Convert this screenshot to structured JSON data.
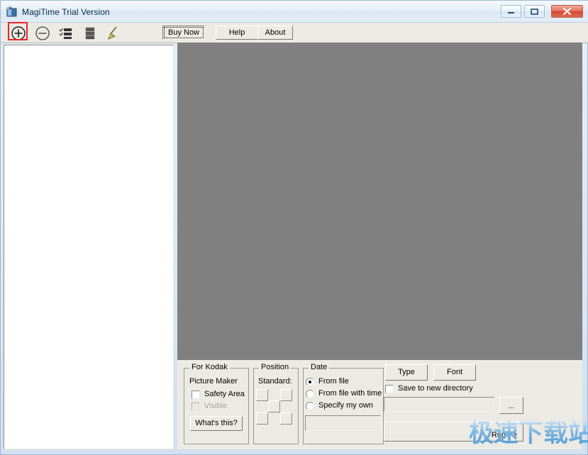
{
  "window": {
    "title": "MagiTime Trial Version",
    "icon": "photo-app-icon",
    "controls": {
      "minimize": "minimize-icon",
      "maximize": "maximize-icon",
      "close": "close-icon"
    }
  },
  "toolbar": {
    "icons": [
      {
        "name": "add-icon",
        "tooltip": "Add"
      },
      {
        "name": "remove-icon",
        "tooltip": "Remove"
      },
      {
        "name": "select-list-icon",
        "tooltip": "Select All"
      },
      {
        "name": "list-icon",
        "tooltip": "List"
      },
      {
        "name": "broom-icon",
        "tooltip": "Clear"
      }
    ],
    "selected_icon_index": 0,
    "buttons": {
      "buy_now": "Buy Now",
      "help": "Help",
      "about": "About"
    }
  },
  "left_panel": {
    "name": "file-list",
    "items": []
  },
  "preview": {
    "name": "image-preview-area",
    "background_color": "#808080"
  },
  "bottom": {
    "kodak_group": {
      "legend": "For Kodak",
      "subtitle": "Picture Maker",
      "checkboxes": [
        {
          "label": "Safety Area",
          "checked": false,
          "enabled": true
        },
        {
          "label": "Visible",
          "checked": false,
          "enabled": false
        }
      ],
      "button": "What's this?"
    },
    "position_group": {
      "legend": "Position",
      "subtitle": "Standard:",
      "cells": 9
    },
    "date_group": {
      "legend": "Date",
      "radios": [
        {
          "label": "From file",
          "selected": true
        },
        {
          "label": "From file with time",
          "selected": false
        },
        {
          "label": "Specify my own",
          "selected": false
        }
      ],
      "custom_date_value": "",
      "custom_date_placeholder": ""
    },
    "actions": {
      "type_button": "Type",
      "font_button": "Font",
      "save_checkbox": {
        "label": "Save to new directory",
        "checked": false
      },
      "directory_value": "",
      "browse_button": "...",
      "run_button": "Run >>"
    }
  },
  "watermark": {
    "text": "极速下载站",
    "color": "#79b4e0"
  }
}
